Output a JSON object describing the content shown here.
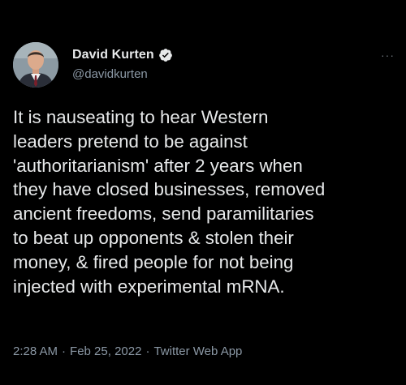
{
  "tweet": {
    "author": {
      "display_name": "David Kurten",
      "handle": "@davidkurten",
      "verified_icon": "verified-badge-icon",
      "avatar": "avatar-photo"
    },
    "more_icon": "more-options-icon",
    "more_label": "···",
    "text": "It is nauseating to hear Western\nleaders pretend to be against\n'authoritarianism' after 2 years when\nthey have closed businesses, removed\nancient freedoms, send paramilitaries\nto beat up opponents & stolen their\nmoney, & fired people for not being\ninjected with experimental mRNA.",
    "time": "2:28 AM",
    "separator": "·",
    "date": "Feb 25, 2022",
    "source": "Twitter Web App"
  },
  "colors": {
    "background": "#000000",
    "text": "#e7e9ea",
    "secondary": "#8b98a5"
  }
}
